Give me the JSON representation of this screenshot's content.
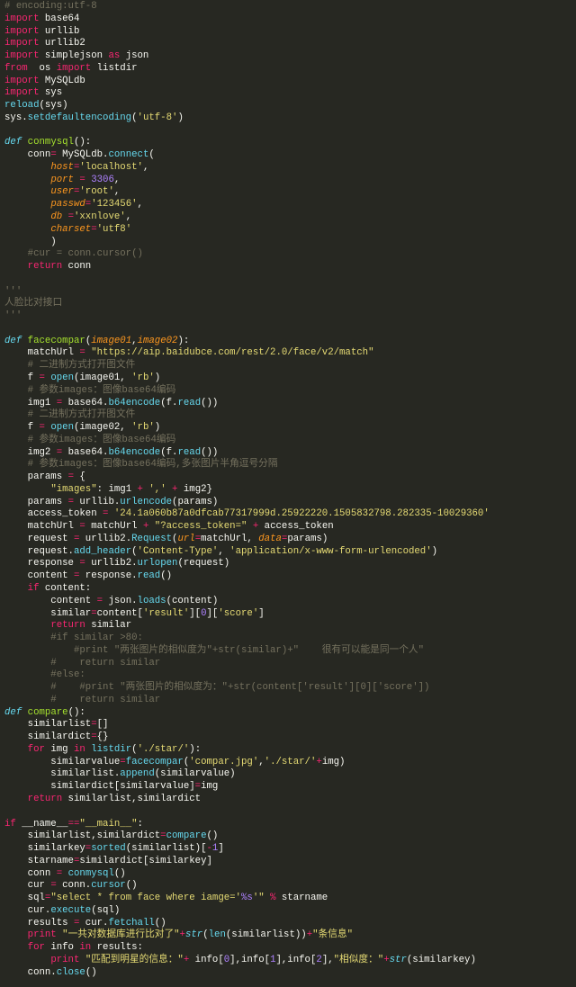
{
  "editor": {
    "colors": {
      "background": "#272822",
      "keyword": "#f92672",
      "function": "#a6e22e",
      "builtin": "#66d9ef",
      "string": "#e6db74",
      "param": "#fd971f",
      "comment": "#75715e",
      "number": "#ae81ff",
      "text": "#f8f8f2"
    },
    "lines": [
      [
        [
          "c",
          "# encoding:utf-8"
        ]
      ],
      [
        [
          "k",
          "import"
        ],
        [
          "t",
          " base64"
        ]
      ],
      [
        [
          "k",
          "import"
        ],
        [
          "t",
          " urllib"
        ]
      ],
      [
        [
          "k",
          "import"
        ],
        [
          "t",
          " urllib2"
        ]
      ],
      [
        [
          "k",
          "import"
        ],
        [
          "t",
          " simplejson "
        ],
        [
          "k",
          "as"
        ],
        [
          "t",
          " json"
        ]
      ],
      [
        [
          "k",
          "from"
        ],
        [
          "t",
          "  os "
        ],
        [
          "k",
          "import"
        ],
        [
          "t",
          " listdir"
        ]
      ],
      [
        [
          "k",
          "import"
        ],
        [
          "t",
          " MySQLdb"
        ]
      ],
      [
        [
          "k",
          "import"
        ],
        [
          "t",
          " sys"
        ]
      ],
      [
        [
          "b",
          "reload"
        ],
        [
          "t",
          "(sys)"
        ]
      ],
      [
        [
          "t",
          "sys."
        ],
        [
          "b",
          "setdefaultencoding"
        ],
        [
          "t",
          "("
        ],
        [
          "s",
          "'utf-8'"
        ],
        [
          "t",
          ")"
        ]
      ],
      [],
      [
        [
          "d",
          "def"
        ],
        [
          "t",
          " "
        ],
        [
          "f",
          "conmysql"
        ],
        [
          "t",
          "():"
        ]
      ],
      [
        [
          "t",
          "    conn"
        ],
        [
          "o",
          "="
        ],
        [
          "t",
          " MySQLdb."
        ],
        [
          "b",
          "connect"
        ],
        [
          "t",
          "("
        ]
      ],
      [
        [
          "t",
          "        "
        ],
        [
          "p",
          "host"
        ],
        [
          "o",
          "="
        ],
        [
          "s",
          "'localhost'"
        ],
        [
          "t",
          ","
        ]
      ],
      [
        [
          "t",
          "        "
        ],
        [
          "p",
          "port"
        ],
        [
          "t",
          " "
        ],
        [
          "o",
          "="
        ],
        [
          "t",
          " "
        ],
        [
          "n",
          "3306"
        ],
        [
          "t",
          ","
        ]
      ],
      [
        [
          "t",
          "        "
        ],
        [
          "p",
          "user"
        ],
        [
          "o",
          "="
        ],
        [
          "s",
          "'root'"
        ],
        [
          "t",
          ","
        ]
      ],
      [
        [
          "t",
          "        "
        ],
        [
          "p",
          "passwd"
        ],
        [
          "o",
          "="
        ],
        [
          "s",
          "'123456'"
        ],
        [
          "t",
          ","
        ]
      ],
      [
        [
          "t",
          "        "
        ],
        [
          "p",
          "db"
        ],
        [
          "t",
          " "
        ],
        [
          "o",
          "="
        ],
        [
          "s",
          "'xxnlove'"
        ],
        [
          "t",
          ","
        ]
      ],
      [
        [
          "t",
          "        "
        ],
        [
          "p",
          "charset"
        ],
        [
          "o",
          "="
        ],
        [
          "s",
          "'utf8'"
        ]
      ],
      [
        [
          "t",
          "        )"
        ]
      ],
      [
        [
          "c",
          "    #cur = conn.cursor()"
        ]
      ],
      [
        [
          "t",
          "    "
        ],
        [
          "k",
          "return"
        ],
        [
          "t",
          " conn"
        ]
      ],
      [],
      [
        [
          "c",
          "'''"
        ]
      ],
      [
        [
          "c",
          "人脸比对接口"
        ]
      ],
      [
        [
          "c",
          "'''"
        ]
      ],
      [],
      [
        [
          "d",
          "def"
        ],
        [
          "t",
          " "
        ],
        [
          "f",
          "facecompar"
        ],
        [
          "t",
          "("
        ],
        [
          "p",
          "image01"
        ],
        [
          "t",
          ","
        ],
        [
          "p",
          "image02"
        ],
        [
          "t",
          "):"
        ]
      ],
      [
        [
          "t",
          "    matchUrl "
        ],
        [
          "o",
          "="
        ],
        [
          "t",
          " "
        ],
        [
          "s",
          "\"https://aip.baidubce.com/rest/2.0/face/v2/match\""
        ]
      ],
      [
        [
          "c",
          "    # 二进制方式打开图文件"
        ]
      ],
      [
        [
          "t",
          "    f "
        ],
        [
          "o",
          "="
        ],
        [
          "t",
          " "
        ],
        [
          "b",
          "open"
        ],
        [
          "t",
          "(image01, "
        ],
        [
          "s",
          "'rb'"
        ],
        [
          "t",
          ")"
        ]
      ],
      [
        [
          "c",
          "    # 参数images：图像base64编码"
        ]
      ],
      [
        [
          "t",
          "    img1 "
        ],
        [
          "o",
          "="
        ],
        [
          "t",
          " base64."
        ],
        [
          "b",
          "b64encode"
        ],
        [
          "t",
          "(f."
        ],
        [
          "b",
          "read"
        ],
        [
          "t",
          "())"
        ]
      ],
      [
        [
          "c",
          "    # 二进制方式打开图文件"
        ]
      ],
      [
        [
          "t",
          "    f "
        ],
        [
          "o",
          "="
        ],
        [
          "t",
          " "
        ],
        [
          "b",
          "open"
        ],
        [
          "t",
          "(image02, "
        ],
        [
          "s",
          "'rb'"
        ],
        [
          "t",
          ")"
        ]
      ],
      [
        [
          "c",
          "    # 参数images：图像base64编码"
        ]
      ],
      [
        [
          "t",
          "    img2 "
        ],
        [
          "o",
          "="
        ],
        [
          "t",
          " base64."
        ],
        [
          "b",
          "b64encode"
        ],
        [
          "t",
          "(f."
        ],
        [
          "b",
          "read"
        ],
        [
          "t",
          "())"
        ]
      ],
      [
        [
          "c",
          "    # 参数images：图像base64编码,多张图片半角逗号分隔"
        ]
      ],
      [
        [
          "t",
          "    params "
        ],
        [
          "o",
          "="
        ],
        [
          "t",
          " {"
        ]
      ],
      [
        [
          "t",
          "        "
        ],
        [
          "s",
          "\"images\""
        ],
        [
          "t",
          ": img1 "
        ],
        [
          "o",
          "+"
        ],
        [
          "t",
          " "
        ],
        [
          "s",
          "','"
        ],
        [
          "t",
          " "
        ],
        [
          "o",
          "+"
        ],
        [
          "t",
          " img2}"
        ]
      ],
      [
        [
          "t",
          "    params "
        ],
        [
          "o",
          "="
        ],
        [
          "t",
          " urllib."
        ],
        [
          "b",
          "urlencode"
        ],
        [
          "t",
          "(params)"
        ]
      ],
      [
        [
          "t",
          "    access_token "
        ],
        [
          "o",
          "="
        ],
        [
          "t",
          " "
        ],
        [
          "s",
          "'24.1a060b87a0dfcab77317999d.25922220.1505832798.282335-10029360'"
        ]
      ],
      [
        [
          "t",
          "    matchUrl "
        ],
        [
          "o",
          "="
        ],
        [
          "t",
          " matchUrl "
        ],
        [
          "o",
          "+"
        ],
        [
          "t",
          " "
        ],
        [
          "s",
          "\"?access_token=\""
        ],
        [
          "t",
          " "
        ],
        [
          "o",
          "+"
        ],
        [
          "t",
          " access_token"
        ]
      ],
      [
        [
          "t",
          "    request "
        ],
        [
          "o",
          "="
        ],
        [
          "t",
          " urllib2."
        ],
        [
          "b",
          "Request"
        ],
        [
          "t",
          "("
        ],
        [
          "p",
          "url"
        ],
        [
          "o",
          "="
        ],
        [
          "t",
          "matchUrl, "
        ],
        [
          "p",
          "data"
        ],
        [
          "o",
          "="
        ],
        [
          "t",
          "params)"
        ]
      ],
      [
        [
          "t",
          "    request."
        ],
        [
          "b",
          "add_header"
        ],
        [
          "t",
          "("
        ],
        [
          "s",
          "'Content-Type'"
        ],
        [
          "t",
          ", "
        ],
        [
          "s",
          "'application/x-www-form-urlencoded'"
        ],
        [
          "t",
          ")"
        ]
      ],
      [
        [
          "t",
          "    response "
        ],
        [
          "o",
          "="
        ],
        [
          "t",
          " urllib2."
        ],
        [
          "b",
          "urlopen"
        ],
        [
          "t",
          "(request)"
        ]
      ],
      [
        [
          "t",
          "    content "
        ],
        [
          "o",
          "="
        ],
        [
          "t",
          " response."
        ],
        [
          "b",
          "read"
        ],
        [
          "t",
          "()"
        ]
      ],
      [
        [
          "t",
          "    "
        ],
        [
          "k",
          "if"
        ],
        [
          "t",
          " content:"
        ]
      ],
      [
        [
          "t",
          "        content "
        ],
        [
          "o",
          "="
        ],
        [
          "t",
          " json."
        ],
        [
          "b",
          "loads"
        ],
        [
          "t",
          "(content)"
        ]
      ],
      [
        [
          "t",
          "        similar"
        ],
        [
          "o",
          "="
        ],
        [
          "t",
          "content["
        ],
        [
          "s",
          "'result'"
        ],
        [
          "t",
          "]["
        ],
        [
          "n",
          "0"
        ],
        [
          "t",
          "]["
        ],
        [
          "s",
          "'score'"
        ],
        [
          "t",
          "]"
        ]
      ],
      [
        [
          "t",
          "        "
        ],
        [
          "k",
          "return"
        ],
        [
          "t",
          " similar"
        ]
      ],
      [
        [
          "c",
          "        #if similar >80:"
        ]
      ],
      [
        [
          "c",
          "            #print \"两张图片的相似度为\"+str(similar)+\"    很有可以能是同一个人\""
        ]
      ],
      [
        [
          "c",
          "        #    return similar"
        ]
      ],
      [
        [
          "c",
          "        #else:"
        ]
      ],
      [
        [
          "c",
          "        #    #print \"两张图片的相似度为：\"+str(content['result'][0]['score'])"
        ]
      ],
      [
        [
          "c",
          "        #    return similar"
        ]
      ],
      [
        [
          "d",
          "def"
        ],
        [
          "t",
          " "
        ],
        [
          "f",
          "compare"
        ],
        [
          "t",
          "():"
        ]
      ],
      [
        [
          "t",
          "    similarlist"
        ],
        [
          "o",
          "="
        ],
        [
          "t",
          "[]"
        ]
      ],
      [
        [
          "t",
          "    similardict"
        ],
        [
          "o",
          "="
        ],
        [
          "t",
          "{}"
        ]
      ],
      [
        [
          "t",
          "    "
        ],
        [
          "k",
          "for"
        ],
        [
          "t",
          " img "
        ],
        [
          "k",
          "in"
        ],
        [
          "t",
          " "
        ],
        [
          "b",
          "listdir"
        ],
        [
          "t",
          "("
        ],
        [
          "s",
          "'./star/'"
        ],
        [
          "t",
          "):"
        ]
      ],
      [
        [
          "t",
          "        similarvalue"
        ],
        [
          "o",
          "="
        ],
        [
          "b",
          "facecompar"
        ],
        [
          "t",
          "("
        ],
        [
          "s",
          "'compar.jpg'"
        ],
        [
          "t",
          ","
        ],
        [
          "s",
          "'./star/'"
        ],
        [
          "o",
          "+"
        ],
        [
          "t",
          "img)"
        ]
      ],
      [
        [
          "t",
          "        similarlist."
        ],
        [
          "b",
          "append"
        ],
        [
          "t",
          "(similarvalue)"
        ]
      ],
      [
        [
          "t",
          "        similardict[similarvalue]"
        ],
        [
          "o",
          "="
        ],
        [
          "t",
          "img"
        ]
      ],
      [
        [
          "t",
          "    "
        ],
        [
          "k",
          "return"
        ],
        [
          "t",
          " similarlist,similardict"
        ]
      ],
      [],
      [
        [
          "k",
          "if"
        ],
        [
          "t",
          " __name__"
        ],
        [
          "o",
          "=="
        ],
        [
          "s",
          "\"__main__\""
        ],
        [
          "t",
          ":"
        ]
      ],
      [
        [
          "t",
          "    similarlist,similardict"
        ],
        [
          "o",
          "="
        ],
        [
          "b",
          "compare"
        ],
        [
          "t",
          "()"
        ]
      ],
      [
        [
          "t",
          "    similarkey"
        ],
        [
          "o",
          "="
        ],
        [
          "b",
          "sorted"
        ],
        [
          "t",
          "(similarlist)["
        ],
        [
          "o",
          "-"
        ],
        [
          "n",
          "1"
        ],
        [
          "t",
          "]"
        ]
      ],
      [
        [
          "t",
          "    starname"
        ],
        [
          "o",
          "="
        ],
        [
          "t",
          "similardict[similarkey]"
        ]
      ],
      [
        [
          "t",
          "    conn "
        ],
        [
          "o",
          "="
        ],
        [
          "t",
          " "
        ],
        [
          "b",
          "conmysql"
        ],
        [
          "t",
          "()"
        ]
      ],
      [
        [
          "t",
          "    cur "
        ],
        [
          "o",
          "="
        ],
        [
          "t",
          " conn."
        ],
        [
          "b",
          "cursor"
        ],
        [
          "t",
          "()"
        ]
      ],
      [
        [
          "t",
          "    sql"
        ],
        [
          "o",
          "="
        ],
        [
          "s",
          "\"select * from face where iamge='"
        ],
        [
          "n",
          "%s"
        ],
        [
          "s",
          "'\""
        ],
        [
          "t",
          " "
        ],
        [
          "o",
          "%"
        ],
        [
          "t",
          " starname"
        ]
      ],
      [
        [
          "t",
          "    cur."
        ],
        [
          "b",
          "execute"
        ],
        [
          "t",
          "(sql)"
        ]
      ],
      [
        [
          "t",
          "    results "
        ],
        [
          "o",
          "="
        ],
        [
          "t",
          " cur."
        ],
        [
          "b",
          "fetchall"
        ],
        [
          "t",
          "()"
        ]
      ],
      [
        [
          "t",
          "    "
        ],
        [
          "k",
          "print"
        ],
        [
          "t",
          " "
        ],
        [
          "s",
          "\"一共对数据库进行比对了\""
        ],
        [
          "o",
          "+"
        ],
        [
          "d",
          "str"
        ],
        [
          "t",
          "("
        ],
        [
          "b",
          "len"
        ],
        [
          "t",
          "(similarlist))"
        ],
        [
          "o",
          "+"
        ],
        [
          "s",
          "\"条信息\""
        ]
      ],
      [
        [
          "t",
          "    "
        ],
        [
          "k",
          "for"
        ],
        [
          "t",
          " info "
        ],
        [
          "k",
          "in"
        ],
        [
          "t",
          " results:"
        ]
      ],
      [
        [
          "t",
          "        "
        ],
        [
          "k",
          "print"
        ],
        [
          "t",
          " "
        ],
        [
          "s",
          "\"匹配到明星的信息：\""
        ],
        [
          "o",
          "+"
        ],
        [
          "t",
          " info["
        ],
        [
          "n",
          "0"
        ],
        [
          "t",
          "],info["
        ],
        [
          "n",
          "1"
        ],
        [
          "t",
          "],info["
        ],
        [
          "n",
          "2"
        ],
        [
          "t",
          "],"
        ],
        [
          "s",
          "\"相似度：\""
        ],
        [
          "o",
          "+"
        ],
        [
          "d",
          "str"
        ],
        [
          "t",
          "(similarkey)"
        ]
      ],
      [
        [
          "t",
          "    conn."
        ],
        [
          "b",
          "close"
        ],
        [
          "t",
          "()"
        ]
      ]
    ]
  }
}
